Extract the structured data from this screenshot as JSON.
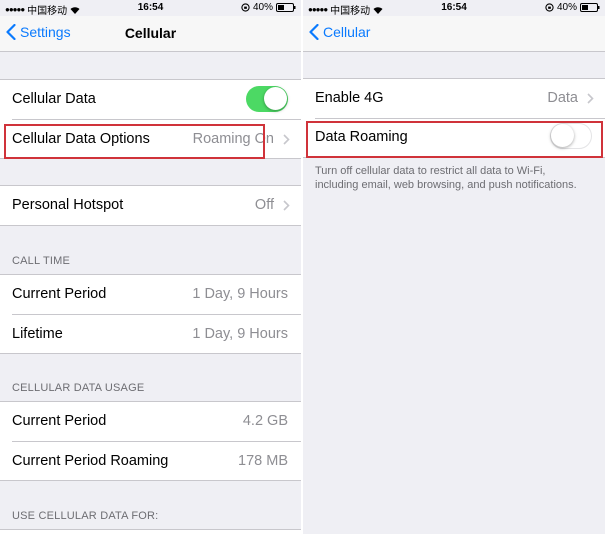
{
  "left": {
    "status": {
      "carrier": "中国移动",
      "time": "16:54",
      "battery": "40%"
    },
    "nav": {
      "back_label": "Settings",
      "title": "Cellular"
    },
    "cellular_data": {
      "label": "Cellular Data",
      "toggle_on": true
    },
    "cellular_data_options": {
      "label": "Cellular Data Options",
      "value": "Roaming On"
    },
    "personal_hotspot": {
      "label": "Personal Hotspot",
      "value": "Off"
    },
    "call_time": {
      "header": "CALL TIME",
      "rows": [
        {
          "label": "Current Period",
          "value": "1 Day, 9 Hours"
        },
        {
          "label": "Lifetime",
          "value": "1 Day, 9 Hours"
        }
      ]
    },
    "usage": {
      "header": "CELLULAR DATA USAGE",
      "rows": [
        {
          "label": "Current Period",
          "value": "4.2 GB"
        },
        {
          "label": "Current Period Roaming",
          "value": "178 MB"
        }
      ]
    },
    "use_for_header": "USE CELLULAR DATA FOR:"
  },
  "right": {
    "status": {
      "carrier": "中国移动",
      "time": "16:54",
      "battery": "40%"
    },
    "nav": {
      "back_label": "Cellular"
    },
    "enable_4g": {
      "label": "Enable 4G",
      "value": "Data"
    },
    "data_roaming": {
      "label": "Data Roaming",
      "toggle_on": false
    },
    "footer": "Turn off cellular data to restrict all data to Wi-Fi, including email, web browsing, and push notifications."
  },
  "colors": {
    "accent": "#0a7afe",
    "toggle_on": "#4cd964",
    "highlight": "#d0333a",
    "background": "#efeff4"
  }
}
